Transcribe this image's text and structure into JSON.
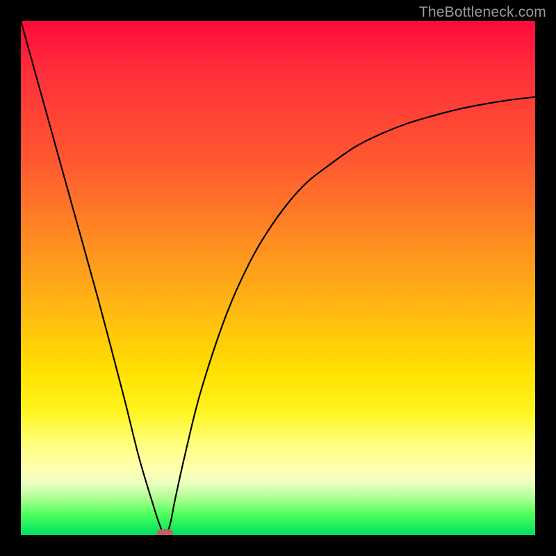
{
  "watermark": "TheBottleneck.com",
  "chart_data": {
    "type": "line",
    "title": "",
    "xlabel": "",
    "ylabel": "",
    "xlim": [
      0,
      100
    ],
    "ylim": [
      0,
      100
    ],
    "grid": false,
    "legend": false,
    "curve": {
      "name": "bottleneck-curve",
      "x": [
        0,
        5,
        10,
        15,
        20,
        23,
        26,
        27,
        28,
        29,
        30,
        32,
        35,
        40,
        45,
        50,
        55,
        60,
        65,
        70,
        75,
        80,
        85,
        90,
        95,
        100
      ],
      "y": [
        100,
        82,
        64,
        46,
        27,
        15,
        5,
        2,
        0,
        2,
        7,
        16,
        28,
        43,
        54,
        62,
        68,
        72,
        75.5,
        78,
        80,
        81.5,
        82.8,
        83.8,
        84.6,
        85.2
      ]
    },
    "min_marker": {
      "x": 28,
      "y": 0
    },
    "gradient_stops": [
      {
        "pos": 0,
        "color": "#ff0a3a"
      },
      {
        "pos": 50,
        "color": "#ff9a18"
      },
      {
        "pos": 78,
        "color": "#ffff60"
      },
      {
        "pos": 100,
        "color": "#00e060"
      }
    ]
  }
}
